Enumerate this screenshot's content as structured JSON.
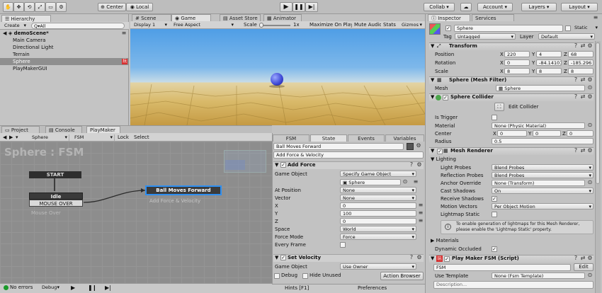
{
  "toolbar": {
    "tools": [
      "✋",
      "✥",
      "⟲",
      "⤢",
      "▭",
      "⚙"
    ],
    "center": "Center",
    "local": "Local",
    "collab": "Collab",
    "account": "Account",
    "layers": "Layers",
    "layout": "Layout"
  },
  "hierarchy": {
    "tab": "Hierarchy",
    "create": "Create",
    "search": "Q▾All",
    "scene": "demoScene*",
    "items": [
      "Main Camera",
      "Directional Light",
      "Terrain",
      "Sphere",
      "PlayMakerGUI"
    ],
    "selected": 3
  },
  "sceneTabs": [
    "Scene",
    "Game",
    "Asset Store",
    "Animator"
  ],
  "gameBar": {
    "display": "Display 1",
    "aspect": "Free Aspect",
    "scale": "Scale",
    "scale_val": "1x",
    "maximize": "Maximize On Play",
    "mute": "Mute Audio",
    "stats": "Stats",
    "gizmos": "Gizmos"
  },
  "bottomTabs": [
    "Project",
    "Console",
    "PlayMaker"
  ],
  "pm": {
    "obj": "Sphere",
    "fsm": "FSM",
    "lock": "Lock",
    "select": "Select",
    "title": "Sphere : FSM",
    "start": "START",
    "idle": "Idle",
    "mouse_over": "MOUSE OVER",
    "ghost": "Mouse Over",
    "ball": "Ball Moves Forward",
    "ball_sub": "Add Force & Velocity",
    "debug": "Debug",
    "noerr": "No errors"
  },
  "fsmPanel": {
    "tabs": [
      "FSM",
      "State",
      "Events",
      "Variables"
    ],
    "state": "Ball Moves Forward",
    "desc": "Add Force & Velocity",
    "addforce": "Add Force",
    "rows": [
      {
        "l": "Game Object",
        "v": "Specify Game Object"
      },
      {
        "l": "",
        "v": "Sphere"
      },
      {
        "l": "At Position",
        "v": "None"
      },
      {
        "l": "Vector",
        "v": "None"
      },
      {
        "l": "X",
        "v": "0"
      },
      {
        "l": "Y",
        "v": "100"
      },
      {
        "l": "Z",
        "v": "0"
      },
      {
        "l": "Space",
        "v": "World"
      },
      {
        "l": "Force Mode",
        "v": "Force"
      },
      {
        "l": "Every Frame",
        "v": ""
      }
    ],
    "setvel": "Set Velocity",
    "sv_go": "Game Object",
    "sv_go_v": "Use Owner",
    "dbg": "Debug",
    "hide": "Hide Unused",
    "action": "Action Browser",
    "hints": "Hints [F1]",
    "prefs": "Preferences"
  },
  "inspector": {
    "tabs": [
      "Inspector",
      "Services"
    ],
    "name": "Sphere",
    "static": "Static",
    "tag": "Tag",
    "tag_v": "Untagged",
    "layer": "Layer",
    "layer_v": "Default",
    "transform": "Transform",
    "pos": "Position",
    "rot": "Rotation",
    "scale": "Scale",
    "px": "220",
    "py": "4",
    "pz": "68",
    "rx": "0",
    "ry": "-84.14101",
    "rz": "-185.296",
    "sx": "8",
    "sy": "8",
    "sz": "8",
    "mf": "Sphere (Mesh Filter)",
    "mesh": "Mesh",
    "mesh_v": "Sphere",
    "col": "Sphere Collider",
    "edit_col": "Edit Collider",
    "trig": "Is Trigger",
    "mat": "Material",
    "mat_v": "None (Physic Material)",
    "center": "Center",
    "cx": "0",
    "cy": "0",
    "cz": "0",
    "radius": "Radius",
    "radius_v": "0.5",
    "mr": "Mesh Renderer",
    "lighting": "Lighting",
    "lp": "Light Probes",
    "lp_v": "Blend Probes",
    "rp": "Reflection Probes",
    "rp_v": "Blend Probes",
    "ao": "Anchor Override",
    "ao_v": "None (Transform)",
    "cs": "Cast Shadows",
    "cs_v": "On",
    "rs": "Receive Shadows",
    "mv": "Motion Vectors",
    "mv_v": "Per Object Motion",
    "ls": "Lightmap Static",
    "info": "To enable generation of lightmaps for this Mesh Renderer, please enable the 'Lightmap Static' property.",
    "materials": "Materials",
    "dyn": "Dynamic Occluded",
    "pmfsm": "Play Maker FSM (Script)",
    "fsm": "FSM",
    "edit": "Edit",
    "usetpl": "Use Template",
    "usetpl_v": "None (Fsm Template)",
    "descr": "Description..."
  }
}
